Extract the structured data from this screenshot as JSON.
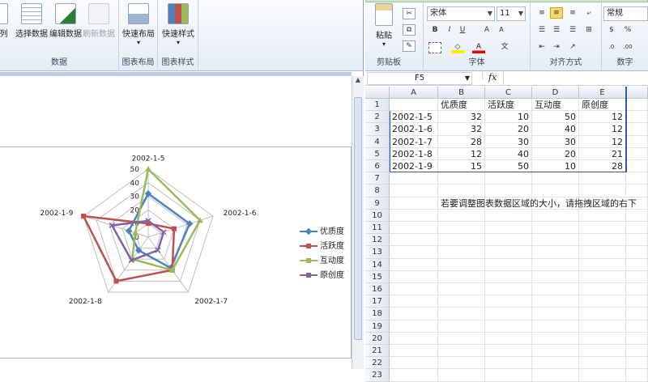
{
  "chart_ribbon": {
    "buttons": [
      {
        "label": "/列",
        "disabled": false
      },
      {
        "label": "选择数据",
        "disabled": false
      },
      {
        "label": "编辑数据",
        "disabled": false
      },
      {
        "label": "刷新数据",
        "disabled": true
      },
      {
        "label": "快速布局",
        "disabled": false
      },
      {
        "label": "快速样式",
        "disabled": false
      }
    ],
    "groups": [
      "数据",
      "图表布局",
      "图表样式"
    ]
  },
  "excel_ribbon": {
    "paste_label": "粘贴",
    "font_name": "宋体",
    "font_size": "11",
    "number_format": "常规",
    "groups": [
      "剪贴板",
      "字体",
      "对齐方式",
      "数字"
    ]
  },
  "formula_bar": {
    "name_box": "F5",
    "fx": "fx"
  },
  "sheet": {
    "columns": [
      "A",
      "B",
      "C",
      "D",
      "E"
    ],
    "header_row": [
      "",
      "优质度",
      "活跃度",
      "互动度",
      "原创度"
    ],
    "rows": [
      [
        "2002-1-5",
        "32",
        "10",
        "50",
        "12"
      ],
      [
        "2002-1-6",
        "32",
        "20",
        "40",
        "12"
      ],
      [
        "2002-1-7",
        "28",
        "30",
        "30",
        "12"
      ],
      [
        "2002-1-8",
        "12",
        "40",
        "20",
        "21"
      ],
      [
        "2002-1-9",
        "15",
        "50",
        "10",
        "28"
      ]
    ],
    "row_numbers": [
      "1",
      "2",
      "3",
      "4",
      "5",
      "6",
      "7",
      "8",
      "9",
      "10",
      "11",
      "12",
      "13",
      "14",
      "15",
      "16",
      "17",
      "18",
      "19",
      "20",
      "21",
      "22",
      "23"
    ],
    "note_row": "9",
    "note": "若要调整图表数据区域的大小，请拖拽区域的右下"
  },
  "chart_data": {
    "type": "radar",
    "categories": [
      "2002-1-5",
      "2002-1-6",
      "2002-1-7",
      "2002-1-8",
      "2002-1-9"
    ],
    "ylim": [
      0,
      50
    ],
    "ticks": [
      "0",
      "10",
      "20",
      "30",
      "40",
      "50"
    ],
    "series": [
      {
        "name": "优质度",
        "values": [
          32,
          32,
          28,
          12,
          15
        ],
        "color": "#4f81bd"
      },
      {
        "name": "活跃度",
        "values": [
          10,
          20,
          30,
          40,
          50
        ],
        "color": "#c0504d"
      },
      {
        "name": "互动度",
        "values": [
          50,
          40,
          30,
          20,
          10
        ],
        "color": "#9bbb59"
      },
      {
        "name": "原创度",
        "values": [
          12,
          12,
          12,
          21,
          28
        ],
        "color": "#8064a2"
      }
    ]
  }
}
